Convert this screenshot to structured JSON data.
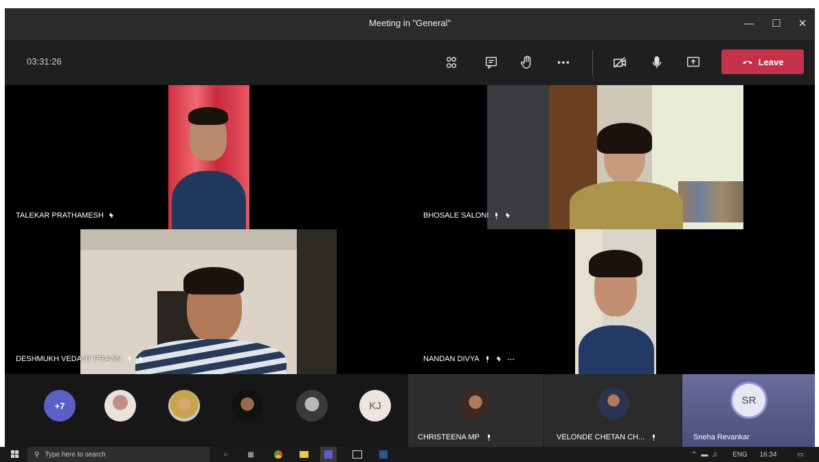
{
  "window": {
    "title": "Meeting in \"General\"",
    "minimize_icon": "minimize-icon",
    "maximize_icon": "maximize-icon",
    "close_icon": "close-icon"
  },
  "toolbar": {
    "timer": "03:31:26",
    "buttons": [
      "participants-icon",
      "chat-icon",
      "raise-hand-icon",
      "more-options-icon",
      "camera-off-icon",
      "microphone-icon",
      "share-screen-icon"
    ],
    "leave_label": "Leave",
    "leave_color": "#c4314b"
  },
  "stage": {
    "participants": [
      {
        "name": "TALEKAR PRATHAMESH",
        "icons": [
          "pin-icon"
        ]
      },
      {
        "name": "BHOSALE SALONI",
        "icons": [
          "mic-icon",
          "pin-icon"
        ]
      },
      {
        "name": "DESHMUKH VEDANT PRAVIN",
        "icons": [
          "mic-icon",
          "pin-icon"
        ]
      },
      {
        "name": "NANDAN DIVYA",
        "icons": [
          "mic-icon",
          "pin-icon",
          "more-icon"
        ]
      }
    ]
  },
  "strip": {
    "overflow_count": "+7",
    "initials": "KJ",
    "tiles": [
      {
        "name": "CHRISTEENA MP",
        "icon": "mic-icon"
      },
      {
        "name": "VELONDE CHETAN CH...",
        "icon": "mic-icon"
      },
      {
        "name": "Sneha Revankar",
        "initials": "SR"
      }
    ]
  },
  "taskbar": {
    "search_placeholder": "Type here to search",
    "lang": "ENG",
    "time": "16:34"
  }
}
